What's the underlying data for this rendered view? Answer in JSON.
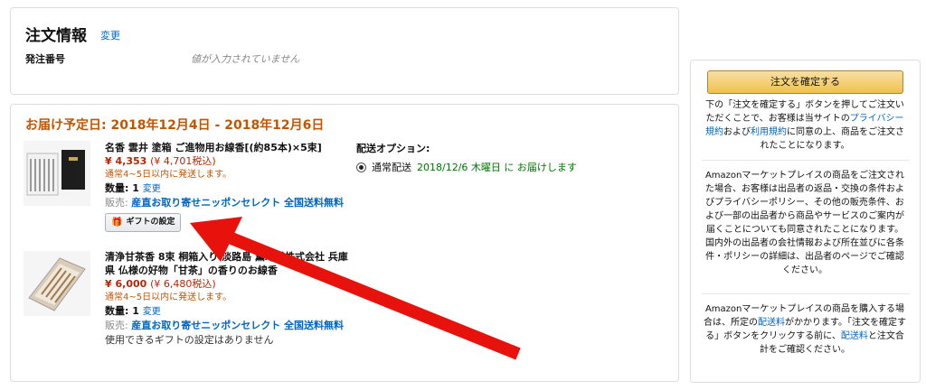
{
  "order_info": {
    "title": "注文情報",
    "change_label": "変更",
    "po_label": "発注番号",
    "po_placeholder": "値が入力されていません"
  },
  "delivery": {
    "header": "お届け予定日: 2018年12月4日 - 2018年12月6日",
    "items": [
      {
        "name": "名香 雲井 塗箱 ご進物用お線香[(約85本)×5束]",
        "price": "¥ 4,353",
        "price_tax": "(¥ 4,701税込)",
        "ship_note": "通常4~5日以内に発送します。",
        "qty_label": "数量: 1",
        "qty_change": "変更",
        "seller_label": "販売:",
        "seller": "産直お取り寄せニッポンセレクト 全国送料無料",
        "gift_button": "ギフトの設定"
      },
      {
        "name": "清浄甘茶香 8束 桐箱入り 淡路島 薫寿堂株式会社 兵庫県 仏様の好物「甘茶」の香りのお線香",
        "price": "¥ 6,000",
        "price_tax": "(¥ 6,480税込)",
        "ship_note": "通常4~5日以内に発送します。",
        "qty_label": "数量: 1",
        "qty_change": "変更",
        "seller_label": "販売:",
        "seller": "産直お取り寄せニッポンセレクト 全国送料無料",
        "gift_note": "使用できるギフトの設定はありません"
      }
    ],
    "options": {
      "title": "配送オプション:",
      "label": "通常配送",
      "date": "2018/12/6 木曜日 に お届けします"
    }
  },
  "sidebar": {
    "place_order": "注文を確定する",
    "p1_a": "下の「注文を確定する」ボタンを押してご注文いただくことで、お客様は当サイトの",
    "p1_link1": "プライバシー規約",
    "p1_b": "および",
    "p1_link2": "利用規約",
    "p1_c": "に同意の上、商品をご注文されたことになります。",
    "p2": "Amazonマーケットプレイスの商品をご注文された場合、お客様は出品者の返品・交換の条件およびプライバシーポリシー、その他の販売条件、および一部の出品者から商品やサービスのご案内が届くことについても同意されたことになります。国内外の出品者の会社情報および所在並びに各条件・ポリシーの詳細は、出品者のページでご確認ください。",
    "p3_a": "Amazonマーケットプレイスの商品を購入する場合は、所定の",
    "p3_link1": "配送料",
    "p3_b": "がかかります。「注文を確定する」ボタンをクリックする前に、",
    "p3_link2": "配送料",
    "p3_c": "と注文合計をご確認ください。"
  },
  "annotation": {
    "color": "#e8120c"
  }
}
